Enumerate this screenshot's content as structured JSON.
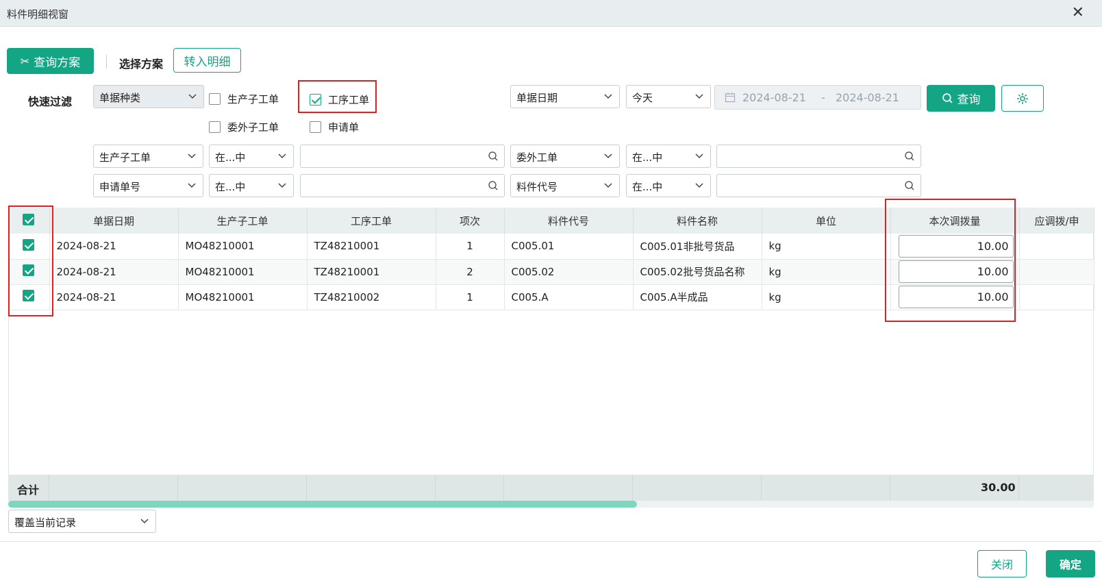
{
  "window": {
    "title": "料件明细视窗",
    "close": "✕"
  },
  "toolbar": {
    "query_plan": "查询方案",
    "select_plan": "选择方案",
    "import_detail": "转入明细"
  },
  "filter": {
    "label": "快速过滤",
    "doc_type": "单据种类",
    "checks": [
      {
        "label": "生产子工单",
        "checked": false
      },
      {
        "label": "工序工单",
        "checked": true
      },
      {
        "label": "委外子工单",
        "checked": false
      },
      {
        "label": "申请单",
        "checked": false
      }
    ],
    "date_field": "单据日期",
    "date_preset": "今天",
    "date_from": "2024-08-21",
    "date_sep": "-",
    "date_to": "2024-08-21",
    "query_button": "查询",
    "rows": [
      {
        "field1": "生产子工单",
        "op1": "在...中",
        "field2": "委外工单",
        "op2": "在...中"
      },
      {
        "field1": "申请单号",
        "op1": "在...中",
        "field2": "料件代号",
        "op2": "在...中"
      }
    ]
  },
  "table": {
    "headers": [
      "单据日期",
      "生产子工单",
      "工序工单",
      "项次",
      "料件代号",
      "料件名称",
      "单位",
      "本次调拨量",
      "应调拨/申"
    ],
    "rows": [
      {
        "date": "2024-08-21",
        "mo": "MO48210001",
        "tz": "TZ48210001",
        "seq": "1",
        "code": "C005.01",
        "name": "C005.01非批号货品",
        "unit": "kg",
        "qty": "10.00"
      },
      {
        "date": "2024-08-21",
        "mo": "MO48210001",
        "tz": "TZ48210001",
        "seq": "2",
        "code": "C005.02",
        "name": "C005.02批号货品名称",
        "unit": "kg",
        "qty": "10.00"
      },
      {
        "date": "2024-08-21",
        "mo": "MO48210001",
        "tz": "TZ48210002",
        "seq": "1",
        "code": "C005.A",
        "name": "C005.A半成品",
        "unit": "kg",
        "qty": "10.00"
      }
    ],
    "sum_label": "合计",
    "sum_value": "30.00"
  },
  "footer": {
    "mode": "覆盖当前记录",
    "close": "关闭",
    "confirm": "确定"
  },
  "colors": {
    "accent": "#14a584",
    "highlight": "#e02020"
  }
}
